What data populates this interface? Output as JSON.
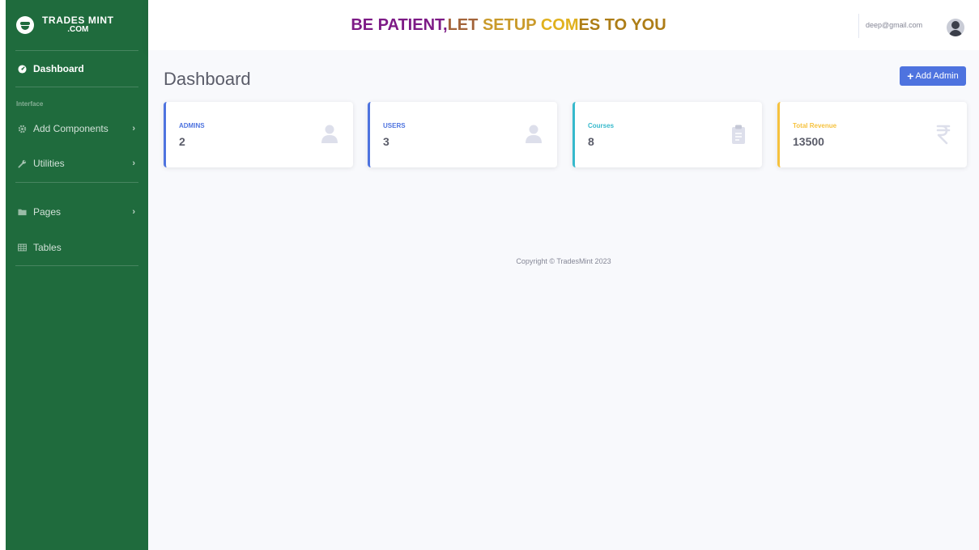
{
  "brand": {
    "line1": "TRADES MINT",
    "line2": ".COM"
  },
  "sidebar": {
    "dashboard": {
      "label": "Dashboard",
      "icon": "tachometer-icon"
    },
    "heading": "Interface",
    "items": [
      {
        "label": "Add Components",
        "icon": "gear-icon",
        "has_chevron": true
      },
      {
        "label": "Utilities",
        "icon": "wrench-icon",
        "has_chevron": true
      },
      {
        "label": "Pages",
        "icon": "folder-icon",
        "has_chevron": true
      },
      {
        "label": "Tables",
        "icon": "table-icon",
        "has_chevron": false
      }
    ],
    "chevron": "›"
  },
  "topbar": {
    "motto_parts": [
      "BE PATIENT,",
      "LET ",
      "SETUP ",
      "COM",
      "ES TO YOU"
    ],
    "user_email": "deep@gmail.com"
  },
  "main": {
    "title": "Dashboard",
    "add_button": {
      "icon": "+",
      "label": "Add Admin"
    },
    "cards": [
      {
        "label": "ADMINS",
        "value": "2",
        "accent": "#4e73df",
        "icon": "user-icon"
      },
      {
        "label": "USERS",
        "value": "3",
        "accent": "#4e73df",
        "icon": "user-icon"
      },
      {
        "label": "Courses",
        "value": "8",
        "accent": "#36b9cc",
        "icon": "clipboard-icon"
      },
      {
        "label": "Total Revenue",
        "value": "13500",
        "accent": "#f6c23e",
        "icon": "rupee-icon"
      }
    ]
  },
  "footer": {
    "copyright": "Copyright © TradesMint 2023"
  },
  "colors": {
    "sidebar": "#1f6b3d",
    "primary": "#4e73df",
    "info": "#36b9cc",
    "warning": "#f6c23e",
    "background": "#f8f9fc"
  }
}
